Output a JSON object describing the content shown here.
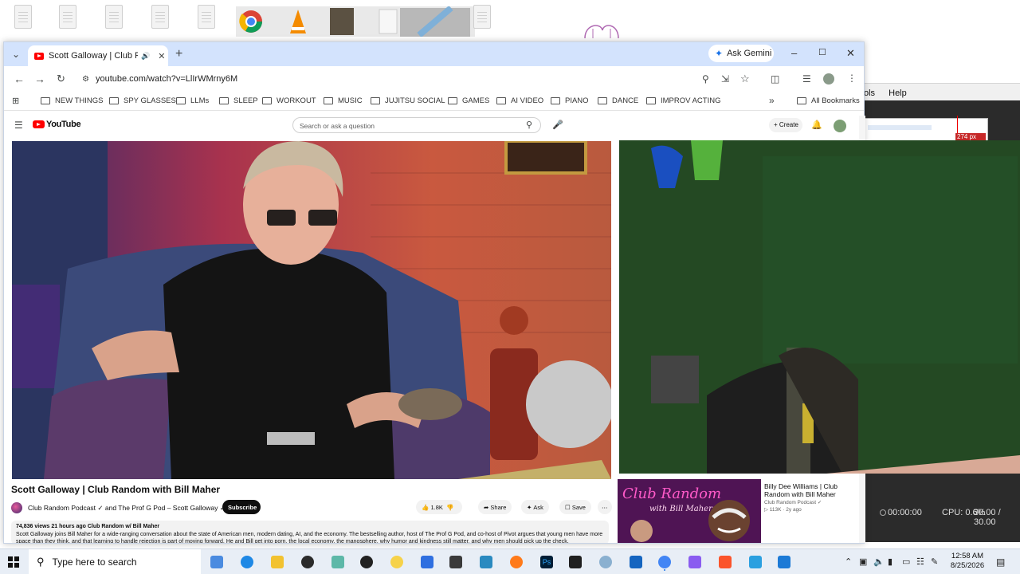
{
  "browser": {
    "tab_title": "Scott Galloway | Club Rando",
    "ask_gemini": "Ask Gemini",
    "url": "youtube.com/watch?v=LlIrWMrny6M",
    "bookmarks": [
      "NEW THINGS",
      "SPY GLASSES",
      "LLMs",
      "SLEEP",
      "WORKOUT",
      "MUSIC",
      "JUJITSU SOCIAL",
      "GAMES",
      "AI VIDEO",
      "PIANO",
      "DANCE",
      "IMPROV ACTING"
    ],
    "all_bookmarks": "All Bookmarks"
  },
  "youtube": {
    "logo": "YouTube",
    "search_placeholder": "Search or ask a question",
    "create": "Create",
    "video_title": "Scott Galloway | Club Random with Bill Maher",
    "channel": "Club Random Podcast ✓ and The Prof G Pod – Scott Galloway ✓",
    "subscribe": "Subscribe",
    "likes": "1.8K",
    "share": "Share",
    "ask": "Ask",
    "save": "Save",
    "meta": "74,836 views  21 hours ago  Club Random w/ Bill Maher",
    "description": "Scott Galloway joins Bill Maher for a wide-ranging conversation about the state of American men, modern dating, AI, and the economy. The bestselling author, host of The Prof G Pod, and co-host of Pivot argues that young men have more space than they think, and that learning to handle rejection is part of moving forward. He and Bill get into porn, the local economy, the manosphere, why humor and kindness still matter, and why men should pick up the check.",
    "recommended": {
      "title": "Billy Dee Williams | Club Random with Bill Maher",
      "channel": "Club Random Podcast ✓",
      "stats": "▷ 113K · 2y ago"
    }
  },
  "background_app": {
    "menu_tools": "ols",
    "menu_help": "Help",
    "size_readout": "274 px",
    "time": "00:00:00",
    "cpu": "CPU: 0.6%",
    "fps": "30.00 / 30.00"
  },
  "taskbar": {
    "search_placeholder": "Type here to search",
    "time": "12:58 AM",
    "date": "8/25/2026"
  }
}
